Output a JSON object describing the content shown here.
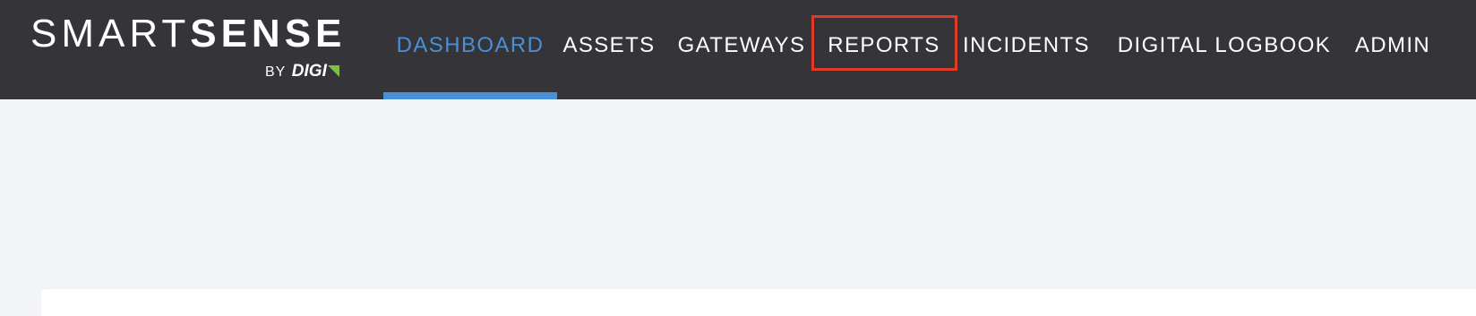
{
  "logo": {
    "smart": "SMART",
    "sense": "SENSE",
    "by": "BY",
    "digi": "DIGI"
  },
  "nav": {
    "items": [
      {
        "label": "DASHBOARD",
        "active": true
      },
      {
        "label": "ASSETS",
        "active": false
      },
      {
        "label": "GATEWAYS",
        "active": false
      },
      {
        "label": "REPORTS",
        "active": false,
        "highlighted": true
      },
      {
        "label": "INCIDENTS",
        "active": false
      },
      {
        "label": "DIGITAL LOGBOOK",
        "active": false
      },
      {
        "label": "ADMIN",
        "active": false
      }
    ]
  },
  "colors": {
    "topbar": "#353438",
    "accent": "#4a90d6",
    "highlight": "#e03b24",
    "background": "#f3f4f8",
    "digi_mark": "#7dbf4a"
  }
}
